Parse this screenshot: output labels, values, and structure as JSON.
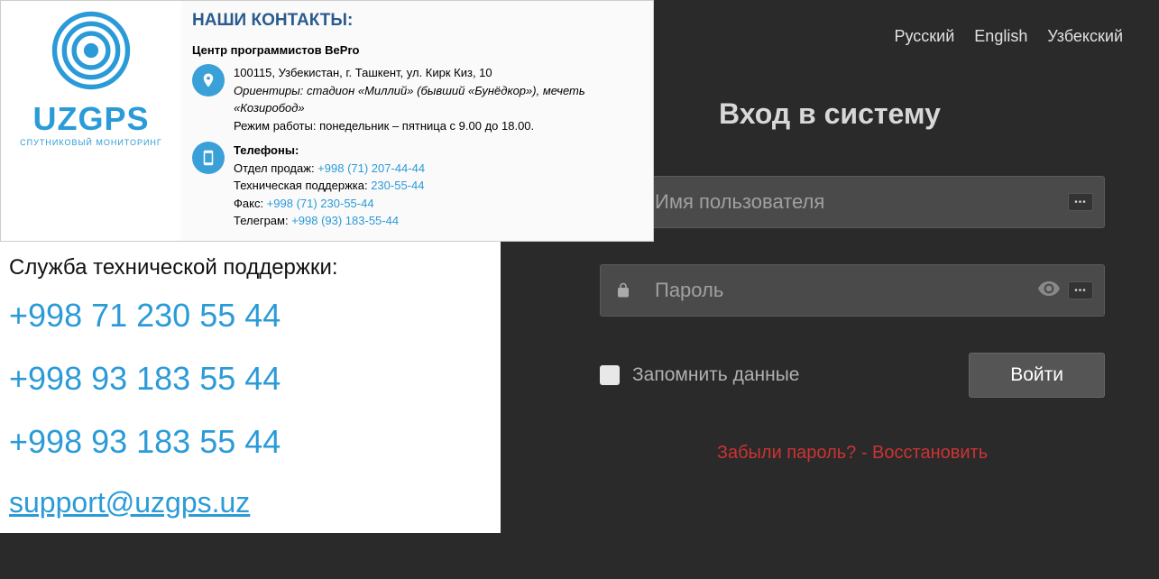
{
  "logo": {
    "brand": "UZGPS",
    "tagline": "СПУТНИКОВЫЙ МОНИТОРИНГ"
  },
  "contacts": {
    "title": "НАШИ КОНТАКТЫ:",
    "center": "Центр программистов BePro",
    "address": "100115, Узбекистан, г. Ташкент, ул. Кирк Киз, 10",
    "landmarks": "Ориентиры: стадион «Миллий» (бывший «Бунёдкор»), мечеть «Козиробод»",
    "hours": "Режим работы: понедельник – пятница с 9.00 до 18.00.",
    "phones_label": "Телефоны:",
    "sales_label": "Отдел продаж: ",
    "sales_phone": "+998 (71) 207-44-44",
    "tech_label": "Техническая поддержка: ",
    "tech_phone": "230-55-44",
    "fax_label": "Факс: ",
    "fax_phone": "+998 (71) 230-55-44",
    "telegram_label": "Телеграм: ",
    "telegram_phone": "+998 (93) 183-55-44"
  },
  "support": {
    "title": "Служба технической поддержки:",
    "phone1": "+998 71 230 55 44",
    "phone2": "+998 93 183 55 44",
    "phone3": "+998 93 183 55 44",
    "email": "support@uzgps.uz"
  },
  "lang": {
    "ru": "Русский",
    "en": "English",
    "uz": "Узбекский"
  },
  "login": {
    "title": "Вход в систему",
    "user_placeholder": "Имя пользователя",
    "pass_placeholder": "Пароль",
    "remember": "Запомнить данные",
    "submit": "Войти",
    "forgot": "Забыли пароль? - Восстановить"
  }
}
